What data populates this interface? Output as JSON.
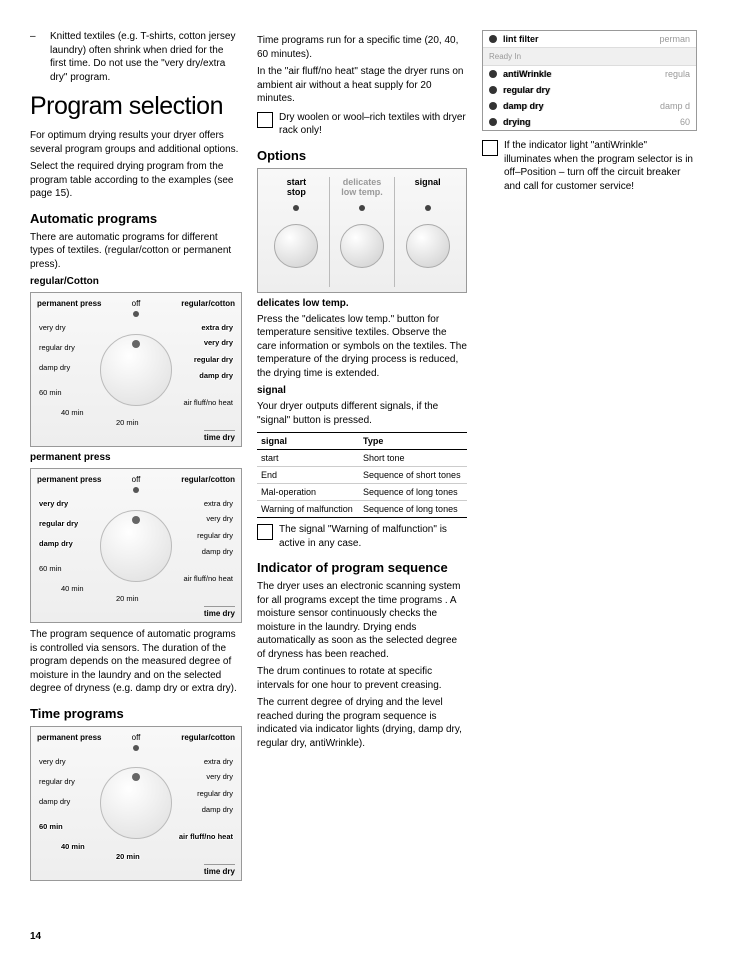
{
  "pageNumber": "14",
  "intro": {
    "bullet": "Knitted textiles (e.g. T-shirts, cotton jersey laundry) often shrink when dried for the first time. Do not use the \"very dry/extra dry\" program."
  },
  "title": "Program selection",
  "p1": "For optimum drying results your dryer offers several program groups and additional options.",
  "p2": "Select the required drying program from the program table according to the examples (see page 15).",
  "auto": {
    "heading": "Automatic programs",
    "text": "There are automatic programs for different types of textiles. (regular/cotton or permanent press).",
    "sub1": "regular/Cotton",
    "sub2": "permanent press",
    "afterText": "The program sequence of automatic programs is controlled via sensors. The duration of the program depends on the measured degree of moisture in the laundry and on the selected degree of dryness (e.g. damp dry or extra dry)."
  },
  "dial": {
    "perm": "permanent press",
    "off": "off",
    "regcot": "regular/cotton",
    "verydry": "very dry",
    "extradry": "extra dry",
    "regulardry": "regular dry",
    "dampdry": "damp dry",
    "m60": "60 min",
    "m40": "40 min",
    "m20": "20 min",
    "airfluff": "air fluff/no heat",
    "timedry": "time dry"
  },
  "time": {
    "heading": "Time programs",
    "p1": "Time programs run for a specific time (20, 40, 60 minutes).",
    "p2": "In the \"air fluff/no heat\" stage the dryer runs on ambient air without a heat supply for 20 minutes.",
    "checkbox": "Dry woolen or wool–rich textiles with dryer rack only!"
  },
  "options": {
    "heading": "Options",
    "col1a": "start",
    "col1b": "stop",
    "col2a": "delicates",
    "col2b": "low temp.",
    "col3": "signal",
    "delicatesHeading": "delicates low temp.",
    "delicatesText": "Press the \"delicates low temp.\" button for temperature sensitive textiles. Observe the care information or symbols on the textiles. The temperature of the drying process is reduced, the drying time is extended.",
    "signalHeading": "signal",
    "signalText": "Your dryer outputs different signals, if the \"signal\" button is pressed."
  },
  "signalTable": {
    "h1": "signal",
    "h2": "Type",
    "r1c1": "start",
    "r1c2": "Short tone",
    "r2c1": "End",
    "r2c2": "Sequence of short tones",
    "r3c1": "Mal-operation",
    "r3c2": "Sequence of long tones",
    "r4c1": "Warning of malfunction",
    "r4c2": "Sequence of long tones"
  },
  "signalNote": "The signal \"Warning of malfunction\" is active in any case.",
  "indicator": {
    "heading": "Indicator of program sequence",
    "p1": "The dryer uses an electronic scanning system for all programs except the time programs . A moisture sensor continuously checks the moisture in the laundry. Drying ends automatically as soon as the selected degree of dryness has been reached.",
    "p2": "The drum continues to rotate at specific intervals for one hour to prevent creasing.",
    "p3": "The current degree of drying and the level reached during the program sequence is indicated via indicator lights (drying, damp dry, regular dry, antiWrinkle).",
    "panel": {
      "lint": "lint filter",
      "perm": "perman",
      "ready": "Ready In",
      "anti": "antiWrinkle",
      "reg": "regular dry",
      "damp": "damp dry",
      "dry": "drying",
      "r_regula": "regula",
      "r_damp": "damp d",
      "r_60": "60"
    },
    "note": "If the indicator light \"antiWrinkle\" illuminates when the program selector is in off–Position – turn off the circuit breaker and call for customer service!"
  }
}
